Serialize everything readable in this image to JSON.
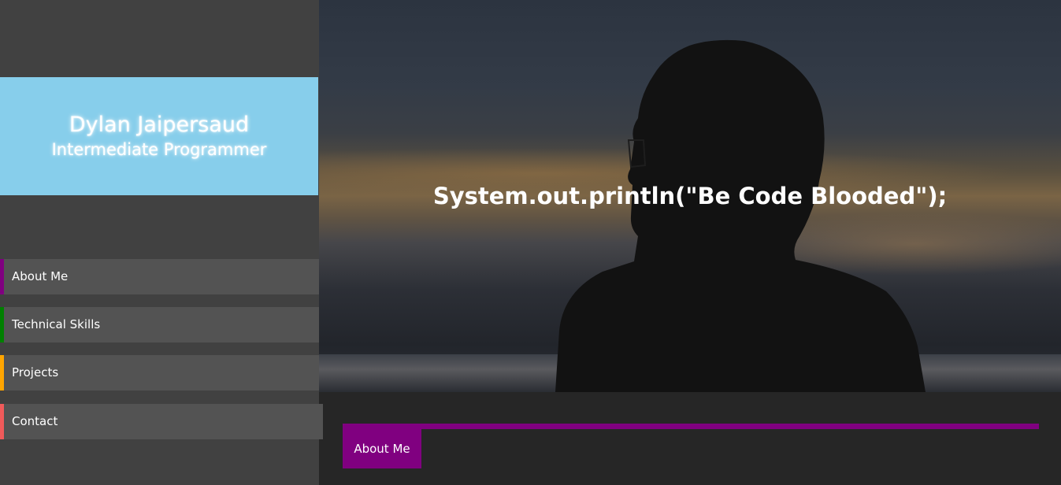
{
  "profile": {
    "name": "Dylan Jaipersaud",
    "title": "Intermediate Programmer"
  },
  "nav": {
    "items": [
      {
        "label": "About Me",
        "accent": "#800080"
      },
      {
        "label": "Technical Skills",
        "accent": "#008000"
      },
      {
        "label": "Projects",
        "accent": "#ffa500"
      },
      {
        "label": "Contact",
        "accent": "#f05a5a"
      }
    ]
  },
  "hero": {
    "tagline": "System.out.println(\"Be Code Blooded\");",
    "image_subject": "silhouette-of-person-at-sunset"
  },
  "section": {
    "heading": "About Me",
    "accent": "#800080"
  },
  "colors": {
    "sidebar_bg": "#414141",
    "name_card_bg": "#87ceeb",
    "nav_item_bg": "#535353",
    "content_bg": "#262626"
  }
}
